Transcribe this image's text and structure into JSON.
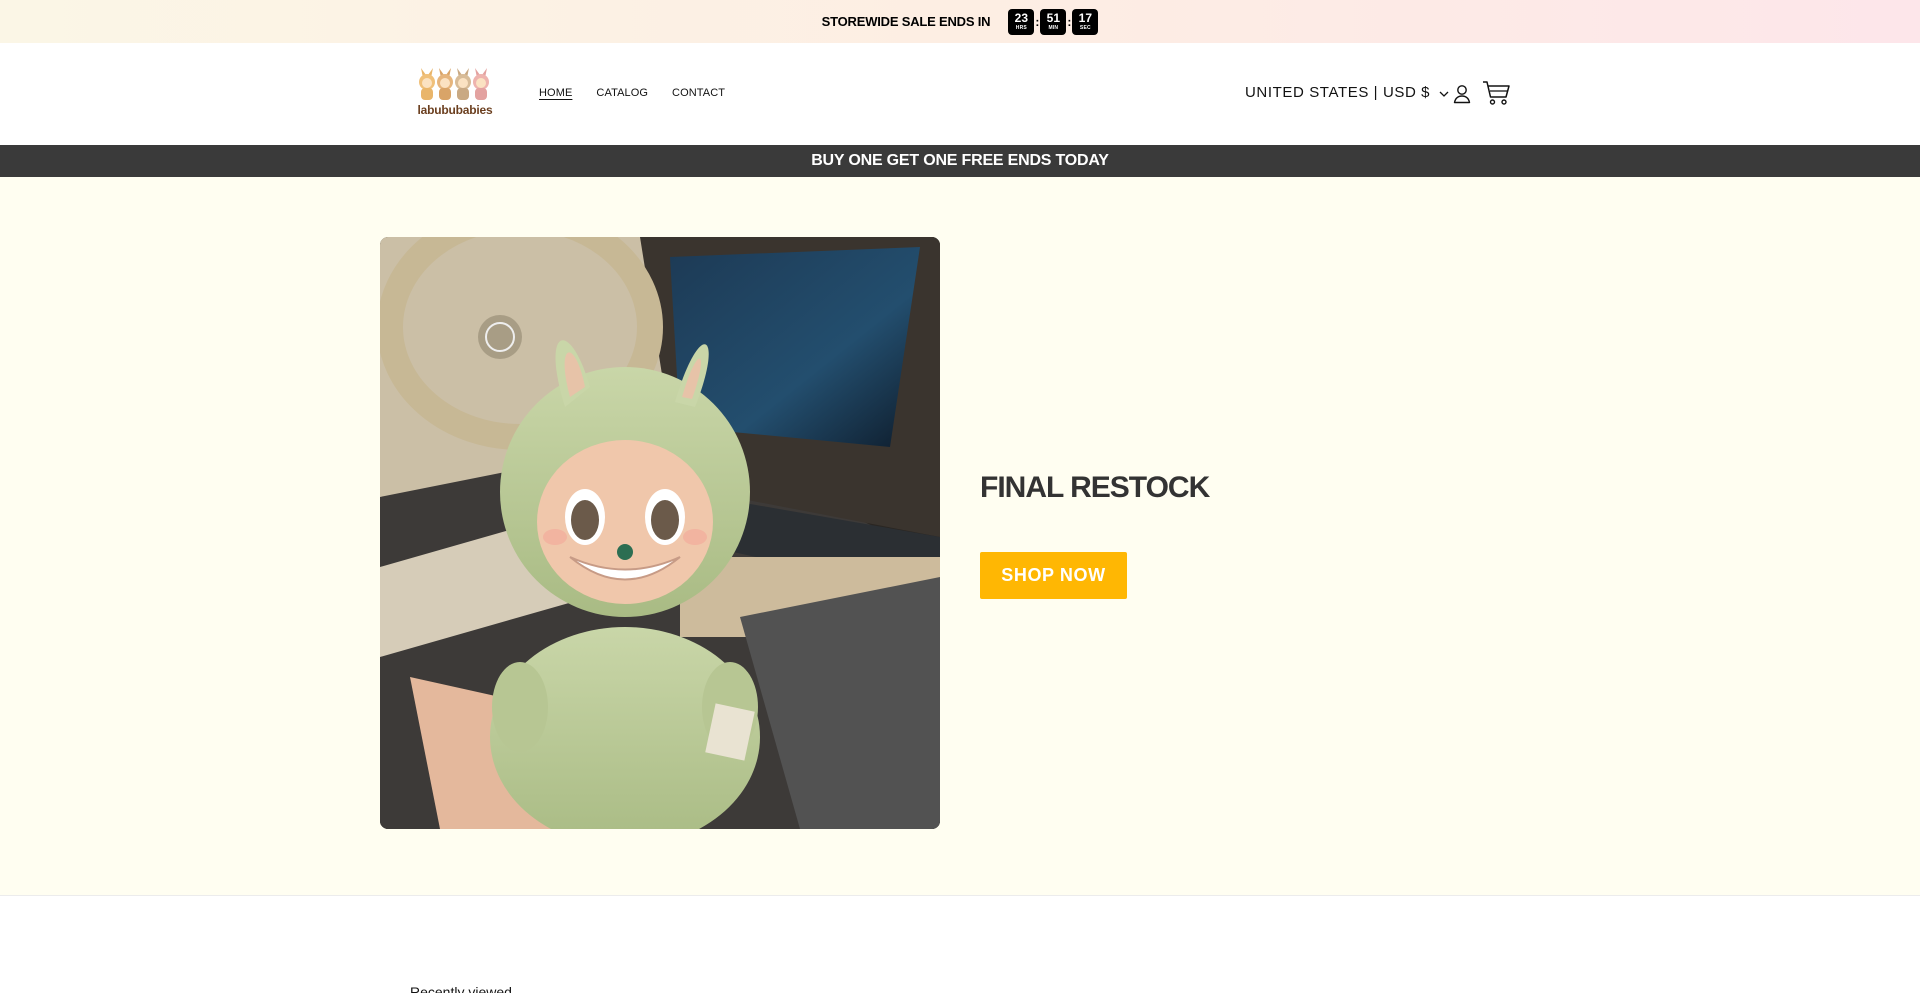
{
  "topbar": {
    "text": "STOREWIDE SALE ENDS IN",
    "countdown": [
      {
        "value": "23",
        "label": "HRS"
      },
      {
        "value": "51",
        "label": "MIN"
      },
      {
        "value": "17",
        "label": "SEC"
      }
    ],
    "separator": ":"
  },
  "header": {
    "logo_text": "labububabies",
    "nav": [
      {
        "label": "HOME",
        "active": true
      },
      {
        "label": "CATALOG",
        "active": false
      },
      {
        "label": "CONTACT",
        "active": false
      }
    ],
    "region": "UNITED STATES | USD $",
    "icons": [
      "chevron-down-icon",
      "account-icon",
      "cart-icon"
    ]
  },
  "promo": {
    "text": "BUY ONE GET ONE FREE ENDS TODAY"
  },
  "hero": {
    "title": "FINAL RESTOCK",
    "button_label": "SHOP NOW",
    "button_color": "#ffb703",
    "background_color": "#fffef1"
  },
  "below": {
    "text": "Recently viewed"
  }
}
